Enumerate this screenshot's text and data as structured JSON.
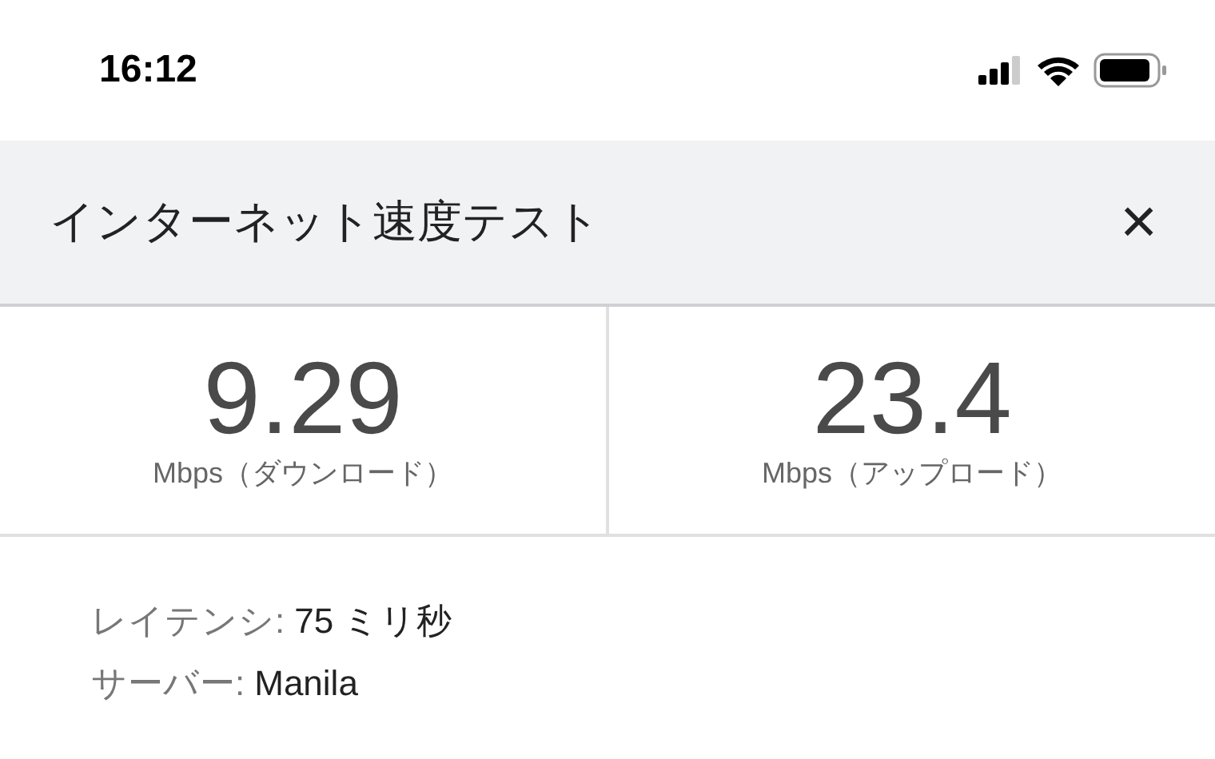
{
  "status_bar": {
    "time": "16:12"
  },
  "header": {
    "title": "インターネット速度テスト",
    "close": "×"
  },
  "results": [
    {
      "value": "9.29",
      "unit": "Mbps（ダウンロード）"
    },
    {
      "value": "23.4",
      "unit": "Mbps（アップロード）"
    }
  ],
  "details": [
    {
      "label": "レイテンシ:",
      "value": "75 ミリ秒"
    },
    {
      "label": "サーバー:",
      "value": "Manila"
    }
  ]
}
